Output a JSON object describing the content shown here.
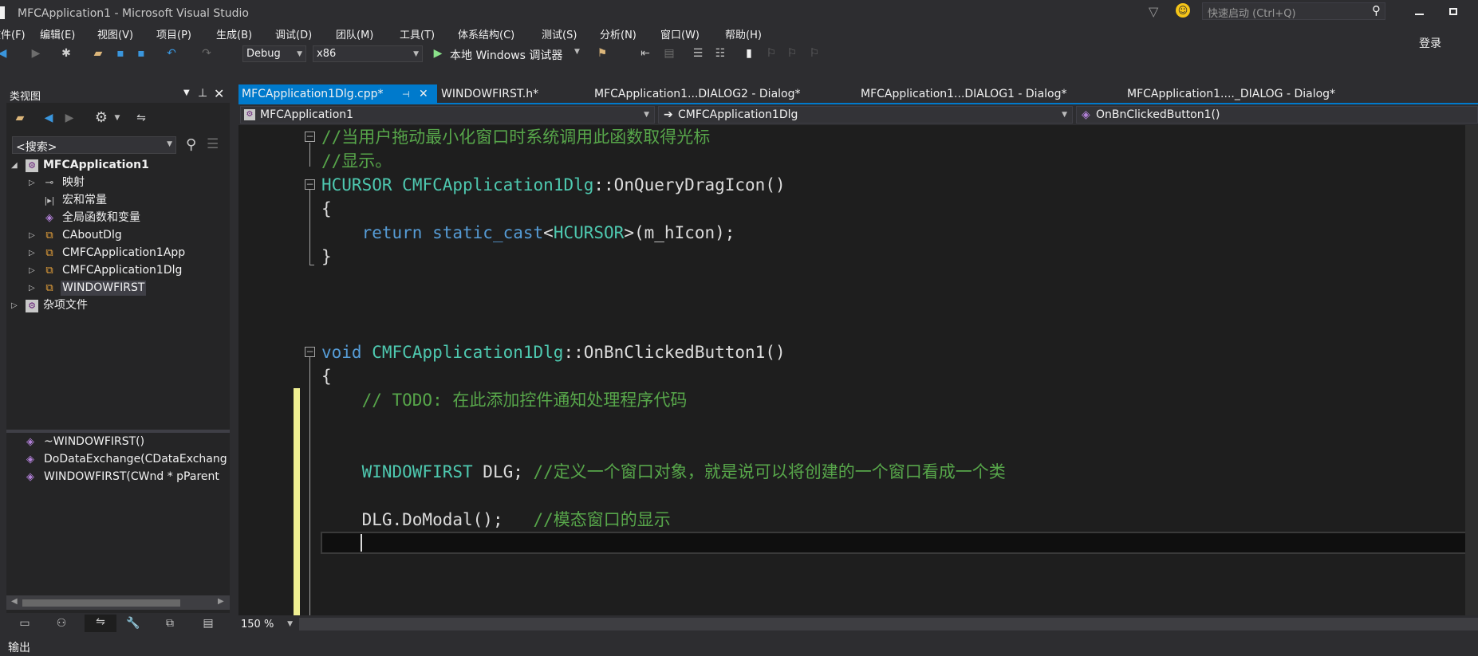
{
  "window": {
    "title": "MFCApplication1 - Microsoft Visual Studio",
    "quick_launch_placeholder": "快速启动 (Ctrl+Q)",
    "sign_in": "登录"
  },
  "menu": [
    "文件(F)",
    "编辑(E)",
    "视图(V)",
    "项目(P)",
    "生成(B)",
    "调试(D)",
    "团队(M)",
    "工具(T)",
    "体系结构(C)",
    "测试(S)",
    "分析(N)",
    "窗口(W)",
    "帮助(H)"
  ],
  "toolbar": {
    "config": "Debug",
    "platform": "x86",
    "debugger": "本地 Windows 调试器"
  },
  "class_view": {
    "title": "类视图",
    "search_placeholder": "<搜索>",
    "tree": [
      {
        "label": "MFCApplication1",
        "icon": "project-icon",
        "level": 0,
        "expanded": true,
        "bold": true
      },
      {
        "label": "映射",
        "icon": "map-icon",
        "level": 1,
        "expanded": false
      },
      {
        "label": "宏和常量",
        "icon": "macro-icon",
        "level": 1,
        "expanded": null
      },
      {
        "label": "全局函数和变量",
        "icon": "global-icon",
        "level": 1,
        "expanded": null
      },
      {
        "label": "CAboutDlg",
        "icon": "class-icon",
        "level": 1,
        "expanded": false
      },
      {
        "label": "CMFCApplication1App",
        "icon": "class-icon",
        "level": 1,
        "expanded": false
      },
      {
        "label": "CMFCApplication1Dlg",
        "icon": "class-icon",
        "level": 1,
        "expanded": false
      },
      {
        "label": "WINDOWFIRST",
        "icon": "class-icon",
        "level": 1,
        "expanded": false,
        "selected": true
      },
      {
        "label": "杂项文件",
        "icon": "folder-icon",
        "level": 0,
        "expanded": false
      }
    ],
    "members": [
      "~WINDOWFIRST()",
      "DoDataExchange(CDataExchang",
      "WINDOWFIRST(CWnd * pParent"
    ]
  },
  "tabs": [
    {
      "label": "MFCApplication1Dlg.cpp*",
      "active": true
    },
    {
      "label": "WINDOWFIRST.h*",
      "active": false
    },
    {
      "label": "MFCApplication1...DIALOG2 - Dialog*",
      "active": false
    },
    {
      "label": "MFCApplication1...DIALOG1 - Dialog*",
      "active": false
    },
    {
      "label": "MFCApplication1...._DIALOG - Dialog*",
      "active": false
    }
  ],
  "navbar": {
    "project": "MFCApplication1",
    "class": "CMFCApplication1Dlg",
    "member": "OnBnClickedButton1()"
  },
  "code": {
    "comment1": "//当用户拖动最小化窗口时系统调用此函数取得光标",
    "comment2": "//显示。",
    "sig1_type": "HCURSOR",
    "sig1_class": "CMFCApplication1Dlg",
    "sig1_func": "::OnQueryDragIcon()",
    "brace_open": "{",
    "brace_close": "}",
    "return_kw": "return",
    "static_cast": "static_cast",
    "return_rest": "(m_hIcon);",
    "sig2_kw": "void",
    "sig2_class": "CMFCApplication1Dlg",
    "sig2_func": "::OnBnClickedButton1()",
    "todo": "// TODO: 在此添加控件通知处理程序代码",
    "decl_type": "WINDOWFIRST",
    "decl_var": " DLG; ",
    "decl_comment": "//定义一个窗口对象，就是说可以将创建的一个窗口看成一个类",
    "call": "DLG.DoModal();   ",
    "call_comment": "//模态窗口的显示"
  },
  "status": {
    "zoom": "150 %",
    "output_label": "输出"
  },
  "colors": {
    "background": "#2d2d30",
    "editor_bg": "#1e1e1e",
    "accent": "#007acc",
    "keyword": "#569cd6",
    "type": "#4ec9b0",
    "comment": "#57a64a"
  }
}
